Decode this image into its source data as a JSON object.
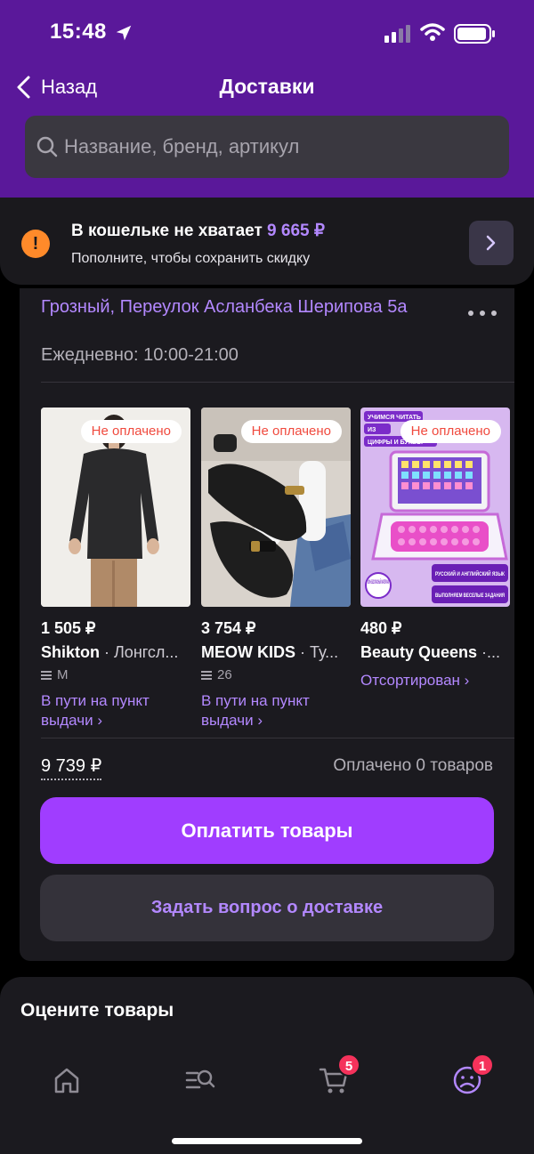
{
  "status_bar": {
    "time": "15:48"
  },
  "header": {
    "back_label": "Назад",
    "title": "Доставки"
  },
  "search": {
    "placeholder": "Название, бренд, артикул"
  },
  "wallet": {
    "title_prefix": "В кошельке не хватает",
    "amount": "9 665 ₽",
    "subtitle": "Пополните, чтобы сохранить скидку"
  },
  "delivery": {
    "address": "Грозный, Переулок Асланбека Шерипова 5а",
    "hours": "Ежедневно: 10:00-21:00",
    "products": [
      {
        "badge": "Не оплачено",
        "price": "1 505 ₽",
        "brand": "Shikton",
        "title": " · Лонгсл...",
        "size": "M",
        "status": "В пути на пункт выдачи ›"
      },
      {
        "badge": "Не оплачено",
        "price": "3 754 ₽",
        "brand": "MEOW KIDS",
        "title": " · Ту...",
        "size": "26",
        "status": "В пути на пункт выдачи ›"
      },
      {
        "badge": "Не оплачено",
        "price": "480 ₽",
        "brand": "Beauty Queens",
        "title": " ·...",
        "size": "",
        "status": "Отсортирован ›",
        "image_text": {
          "top": "УЧИМСЯ ЧИТАТЬ",
          "mid1": "ИЗ",
          "mid2": "ЦИФРЫ И БУКВЫ",
          "seal": "100% БЕЗОПАСНЫЙ МАТЕРИАЛ",
          "label1": "РУССКИЙ И АНГЛИЙСКИЙ ЯЗЫК",
          "label2": "ВЫПОЛНЯЕМ ВЕСЕЛЫЕ ЗАДАНИЯ"
        }
      }
    ],
    "total": "9 739 ₽",
    "paid_text": "Оплачено 0 товаров",
    "pay_button": "Оплатить товары",
    "ask_button": "Задать вопрос о доставке"
  },
  "rate": {
    "title": "Оцените товары"
  },
  "tabbar": {
    "items": [
      {
        "name": "home-icon"
      },
      {
        "name": "catalog-search-icon"
      },
      {
        "name": "cart-icon",
        "badge": "5"
      },
      {
        "name": "profile-icon",
        "badge": "1"
      }
    ]
  },
  "colors": {
    "header": "#5a189a",
    "accent": "#a03dff",
    "link": "#b388ff",
    "badge_red": "#f5325b",
    "warning": "#ff8a2a"
  }
}
